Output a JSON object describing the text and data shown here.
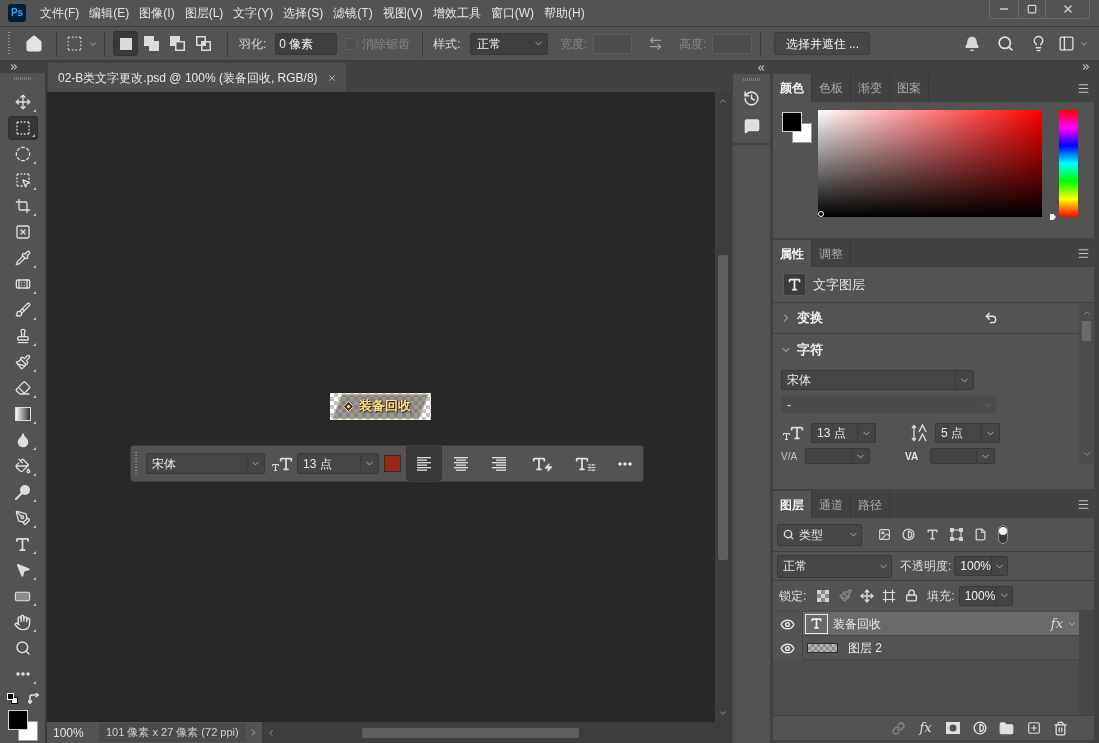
{
  "app": {
    "logo": "Ps"
  },
  "menu": [
    "文件(F)",
    "编辑(E)",
    "图像(I)",
    "图层(L)",
    "文字(Y)",
    "选择(S)",
    "滤镜(T)",
    "视图(V)",
    "增效工具",
    "窗口(W)",
    "帮助(H)"
  ],
  "options_bar": {
    "selection_modes": [
      {
        "kind": "new",
        "selected": true
      },
      {
        "kind": "add",
        "selected": false
      },
      {
        "kind": "subtract",
        "selected": false
      },
      {
        "kind": "intersect",
        "selected": false
      }
    ],
    "feather": {
      "label": "羽化:",
      "value": "0 像素"
    },
    "anti_alias": {
      "label": "消除锯齿",
      "checked": false,
      "disabled": true
    },
    "style": {
      "label": "样式:",
      "value": "正常"
    },
    "width": {
      "label": "宽度:",
      "disabled": true
    },
    "height": {
      "label": "高度:",
      "disabled": true
    },
    "refine_button": "选择并遮住 ..."
  },
  "tools": [
    {
      "kind": "move",
      "selected": false,
      "flyout": true
    },
    {
      "kind": "marquee",
      "selected": true,
      "flyout": true
    },
    {
      "kind": "quick-select",
      "selected": false,
      "flyout": true
    },
    {
      "kind": "object-select",
      "selected": false,
      "flyout": true
    },
    {
      "kind": "crop",
      "selected": false,
      "flyout": true
    },
    {
      "kind": "frame",
      "selected": false,
      "flyout": false
    },
    {
      "kind": "eyedropper",
      "selected": false,
      "flyout": true
    },
    {
      "kind": "healing",
      "selected": false,
      "flyout": true
    },
    {
      "kind": "brush",
      "selected": false,
      "flyout": true
    },
    {
      "kind": "stamp",
      "selected": false,
      "flyout": true
    },
    {
      "kind": "history-brush",
      "selected": false,
      "flyout": true
    },
    {
      "kind": "eraser",
      "selected": false,
      "flyout": true
    },
    {
      "kind": "gradient",
      "selected": false,
      "flyout": true
    },
    {
      "kind": "blur",
      "selected": false,
      "flyout": true
    },
    {
      "kind": "paint-bucket",
      "selected": false,
      "flyout": true
    },
    {
      "kind": "dodge",
      "selected": false,
      "flyout": true
    },
    {
      "kind": "pen",
      "selected": false,
      "flyout": true
    },
    {
      "kind": "type",
      "selected": false,
      "flyout": true
    },
    {
      "kind": "path-select",
      "selected": false,
      "flyout": true
    },
    {
      "kind": "rectangle",
      "selected": false,
      "flyout": true
    },
    {
      "kind": "hand",
      "selected": false,
      "flyout": true
    },
    {
      "kind": "zoom",
      "selected": false,
      "flyout": false
    },
    {
      "kind": "more",
      "selected": false,
      "flyout": true
    }
  ],
  "document_tab": {
    "title": "02-B类文字更改.psd @ 100% (装备回收, RGB/8)"
  },
  "canvas": {
    "layer_text": "装备回收"
  },
  "text_toolbar": {
    "font": "宋体",
    "size": "13 点",
    "color": "#952b16",
    "alignment": [
      {
        "kind": "left",
        "selected": true
      },
      {
        "kind": "center",
        "selected": false
      },
      {
        "kind": "right",
        "selected": false
      }
    ]
  },
  "status_bar": {
    "zoom": "100%",
    "document_info": "101 像素 x 27 像素 (72 ppi)"
  },
  "color_panel": {
    "tabs": [
      {
        "label": "颜色",
        "selected": true
      },
      {
        "label": "色板",
        "selected": false
      },
      {
        "label": "渐变",
        "selected": false
      },
      {
        "label": "图案",
        "selected": false
      }
    ],
    "hue_slider": {
      "level": 0
    }
  },
  "properties_panel": {
    "tabs": [
      {
        "label": "属性",
        "selected": true
      },
      {
        "label": "调整",
        "selected": false
      }
    ],
    "layer_type": "文字图层",
    "sections": [
      {
        "kind": "transform",
        "title": "变换",
        "expanded": false
      },
      {
        "kind": "character",
        "title": "字符",
        "expanded": true
      }
    ],
    "character": {
      "font": "宋体",
      "style": {
        "value": "-",
        "disabled": true
      },
      "size": "13 点",
      "leading": "5 点",
      "kerning_label": "V/A",
      "tracking_label": "VA"
    }
  },
  "layers_panel": {
    "tabs": [
      {
        "label": "图层",
        "selected": true
      },
      {
        "label": "通道",
        "selected": false
      },
      {
        "label": "路径",
        "selected": false
      }
    ],
    "filter": "类型",
    "filter_toggle": {
      "on": true
    },
    "blend_mode": "正常",
    "opacity_label": "不透明度:",
    "opacity": "100%",
    "lock_label": "锁定:",
    "fill_label": "填充:",
    "fill": "100%",
    "layers": [
      {
        "kind": "text",
        "name": "装备回收",
        "visible": true,
        "selected": true,
        "effects": "fx"
      },
      {
        "kind": "image",
        "name": "图层 2",
        "visible": true,
        "selected": false
      }
    ],
    "footer_effects": "fx"
  }
}
